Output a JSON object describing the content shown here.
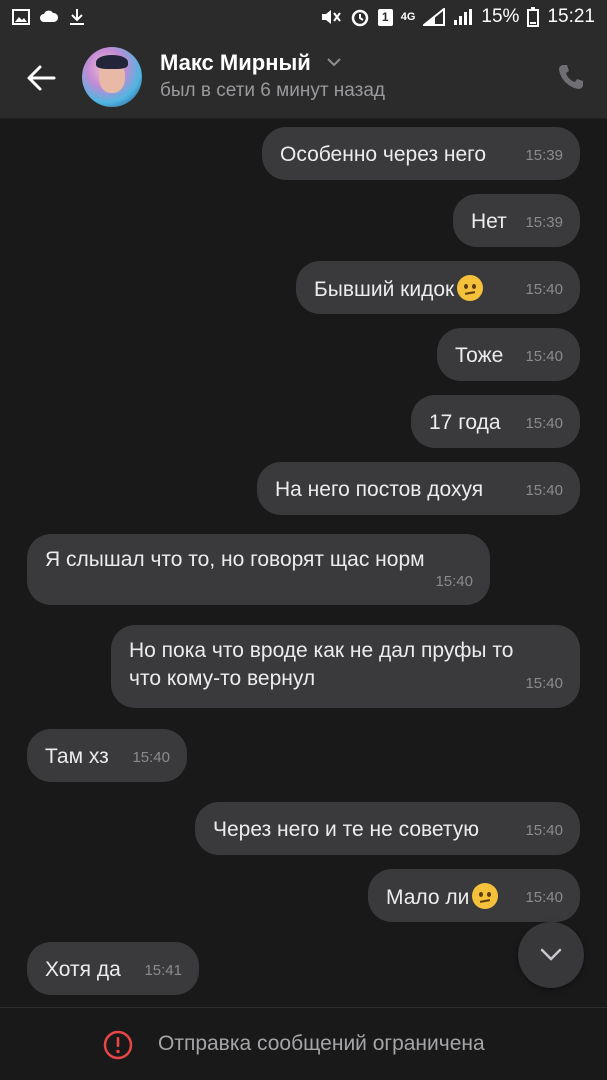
{
  "statusbar": {
    "battery_percent": "15%",
    "time": "15:21",
    "sim_badge": "1",
    "network": "4G"
  },
  "header": {
    "contact_name": "Макс Мирный",
    "status": "был в сети 6 минут назад"
  },
  "messages": [
    {
      "side": "out",
      "text": "Особенно через него",
      "time": "15:39"
    },
    {
      "side": "out",
      "text": "Нет",
      "time": "15:39"
    },
    {
      "side": "out",
      "text": "Бывший кидок",
      "emoji": "confused-face",
      "time": "15:40"
    },
    {
      "side": "out",
      "text": "Тоже",
      "time": "15:40"
    },
    {
      "side": "out",
      "text": "17 года",
      "time": "15:40"
    },
    {
      "side": "out",
      "text": "На него постов дохуя",
      "time": "15:40"
    },
    {
      "side": "in",
      "text": "Я слышал что то, но говорят щас норм",
      "time": "15:40"
    },
    {
      "side": "out",
      "text": "Но пока что вроде как не дал пруфы то\nчто кому-то вернул",
      "time": "15:40"
    },
    {
      "side": "in",
      "text": "Там хз",
      "time": "15:40"
    },
    {
      "side": "out",
      "text": "Через него и те не советую",
      "time": "15:40"
    },
    {
      "side": "out",
      "text": "Мало ли",
      "emoji": "confused-face",
      "time": "15:40"
    },
    {
      "side": "in",
      "text": "Хотя да",
      "time": "15:41"
    }
  ],
  "bottom": {
    "notice": "Отправка сообщений ограничена"
  },
  "colors": {
    "background": "#19191a",
    "header": "#2b2b2c",
    "bubble": "#3a3a3c",
    "warning": "#e64646"
  }
}
